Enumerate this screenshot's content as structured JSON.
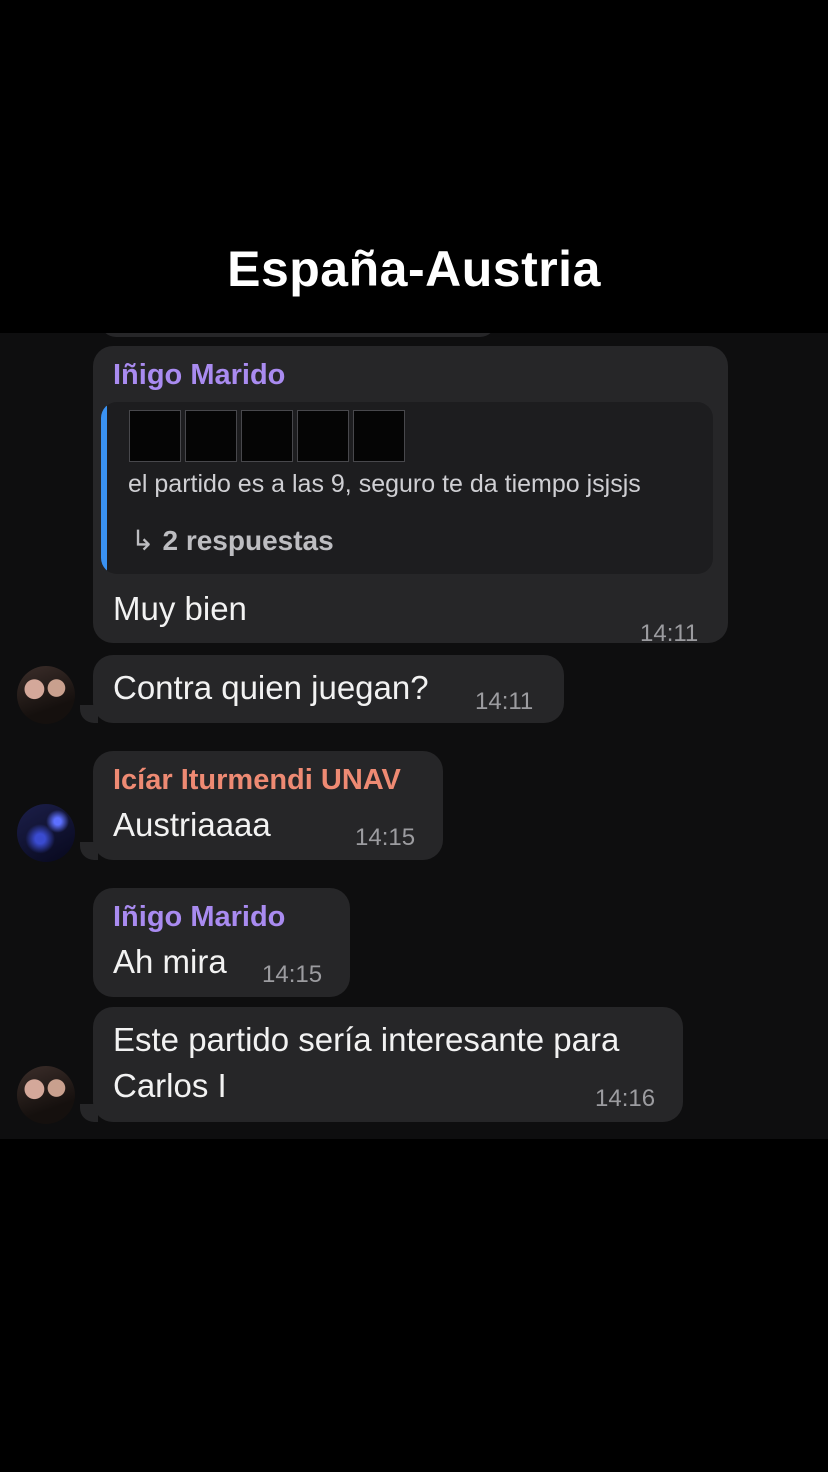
{
  "overlay_title": "España-Austria",
  "messages": [
    {
      "sender": "Iñigo Marido",
      "quote": {
        "redacted_blocks": 5,
        "text": "el partido es a las 9, seguro te da tiempo jsjsjs",
        "replies_icon": "reply-arrow-icon",
        "replies": "2 respuestas"
      },
      "text": "Muy bien",
      "time": "14:11"
    },
    {
      "text": "Contra quien juegan?",
      "time": "14:11",
      "avatar": "couple-avatar"
    },
    {
      "sender": "Icíar Iturmendi UNAV",
      "text": "Austriaaaa",
      "time": "14:15",
      "avatar": "night-sky-avatar"
    },
    {
      "sender": "Iñigo Marido",
      "text": "Ah mira",
      "time": "14:15"
    },
    {
      "text_line1": "Este partido sería interesante para",
      "text_line2": "Carlos I",
      "time": "14:16",
      "avatar": "couple-avatar"
    }
  ],
  "colors": {
    "sender_purple": "#a98bf0",
    "sender_salmon": "#ee8a73",
    "quote_bar": "#3a92f2",
    "bubble": "#262628",
    "chat_background": "#0e0e0f"
  }
}
